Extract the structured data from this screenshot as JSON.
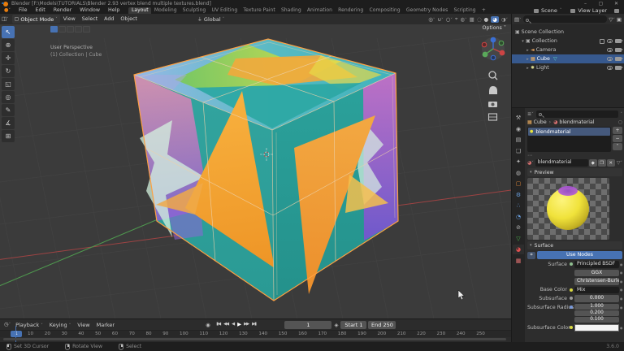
{
  "window": {
    "title": "Blender [F:\\Models\\TUTORIALS\\Blender 2.93 vertex blend multiple textures.blend]",
    "version": "3.6.0",
    "minimize": "–",
    "maximize": "▢",
    "close": "✕"
  },
  "topbar": {
    "menus": [
      "File",
      "Edit",
      "Render",
      "Window",
      "Help"
    ],
    "workspaces": [
      "Layout",
      "Modeling",
      "Sculpting",
      "UV Editing",
      "Texture Paint",
      "Shading",
      "Animation",
      "Rendering",
      "Compositing",
      "Geometry Nodes",
      "Scripting"
    ],
    "add_workspace": "+",
    "scene_label": "Scene",
    "view_layer_label": "View Layer"
  },
  "viewport": {
    "mode": "Object Mode",
    "menu_view": "View",
    "menu_select": "Select",
    "menu_add": "Add",
    "menu_object": "Object",
    "orientation": "Global",
    "options_label": "Options ˅",
    "overlay_line1": "User Perspective",
    "overlay_line2": "(1) Collection | Cube",
    "toolbar": [
      {
        "name": "select-box",
        "glyph": "↖"
      },
      {
        "name": "cursor",
        "glyph": "⊕"
      },
      {
        "name": "move",
        "glyph": "✛"
      },
      {
        "name": "rotate",
        "glyph": "↻"
      },
      {
        "name": "scale",
        "glyph": "◱"
      },
      {
        "name": "transform",
        "glyph": "◎"
      },
      {
        "name": "annotate",
        "glyph": "✎"
      },
      {
        "name": "measure",
        "glyph": "∡"
      },
      {
        "name": "add-cube",
        "glyph": "⊞"
      }
    ]
  },
  "outliner": {
    "rows": [
      {
        "label": "Scene Collection",
        "icon": "▣"
      },
      {
        "label": "Collection",
        "icon": "▣"
      },
      {
        "label": "Camera",
        "icon": "◄"
      },
      {
        "label": "Cube",
        "icon": "▦"
      },
      {
        "label": "Light",
        "icon": "✹"
      }
    ]
  },
  "properties": {
    "tabs": [
      {
        "name": "tool",
        "glyph": "⚒"
      },
      {
        "name": "render",
        "glyph": "◉"
      },
      {
        "name": "output",
        "glyph": "▤"
      },
      {
        "name": "view-layer",
        "glyph": "❏"
      },
      {
        "name": "scene",
        "glyph": "✦"
      },
      {
        "name": "world",
        "glyph": "◍"
      },
      {
        "name": "object",
        "glyph": "▢"
      },
      {
        "name": "modifiers",
        "glyph": "⚙"
      },
      {
        "name": "particles",
        "glyph": "∴"
      },
      {
        "name": "physics",
        "glyph": "◔"
      },
      {
        "name": "constraints",
        "glyph": "⊘"
      },
      {
        "name": "object-data",
        "glyph": "▽"
      },
      {
        "name": "material",
        "glyph": "◕"
      },
      {
        "name": "texture",
        "glyph": "▦"
      }
    ],
    "breadcrumb_object": "Cube",
    "breadcrumb_sep": "›",
    "breadcrumb_material": "blendmaterial",
    "slot_name": "blendmaterial",
    "material_name": "blendmaterial",
    "preview_section": "Preview",
    "surface_section": "Surface",
    "use_nodes_label": "Use Nodes",
    "rows": {
      "surface_label": "Surface",
      "surface_value": "Principled BSDF",
      "distribution": "GGX",
      "sss_method": "Christensen-Burley",
      "base_color_label": "Base Color",
      "base_color_value": "Mix",
      "subsurface_label": "Subsurface",
      "subsurface_value": "0.000",
      "radius_label": "Subsurface Radius",
      "radius_1": "1.000",
      "radius_2": "0.200",
      "radius_3": "0.100",
      "sss_color_label": "Subsurface Color"
    }
  },
  "timeline": {
    "menus": [
      "Playback",
      "Keying",
      "View",
      "Marker"
    ],
    "autokey_glyph": "◉",
    "transport": [
      "▮◀",
      "◀◀",
      "◀",
      "▶",
      "▶▶",
      "▶▮"
    ],
    "current_frame": "1",
    "start_label": "Start",
    "start_value": "1",
    "end_label": "End",
    "end_value": "250",
    "playhead_label": "1",
    "ticks": [
      "10",
      "20",
      "30",
      "40",
      "50",
      "60",
      "70",
      "80",
      "90",
      "100",
      "110",
      "120",
      "130",
      "140",
      "150",
      "160",
      "170",
      "180",
      "190",
      "200",
      "210",
      "220",
      "230",
      "240",
      "250"
    ]
  },
  "statusbar": {
    "items": [
      {
        "label": "Set 3D Cursor"
      },
      {
        "label": "Rotate View"
      },
      {
        "label": "Select"
      }
    ]
  },
  "colors": {
    "accent": "#4772b3",
    "selection_outline": "#ff9e3d",
    "teal": "#2aa29c",
    "orange": "#f2a138"
  }
}
